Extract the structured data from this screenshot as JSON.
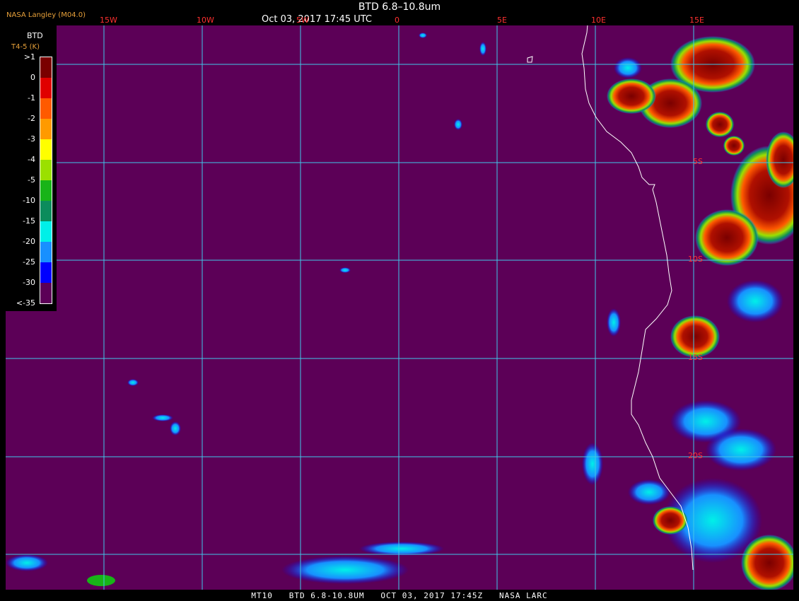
{
  "header": {
    "title": "BTD 6.8–10.8um",
    "time": "Oct 03, 2017 17:45 UTC",
    "source": "NASA Langley (M04.0)"
  },
  "legend": {
    "title": "BTD",
    "subtitle": "T4-5 (K)",
    "ticks": [
      ">1",
      "0",
      "-1",
      "-2",
      "-3",
      "-4",
      "-5",
      "-10",
      "-15",
      "-20",
      "-25",
      "-30",
      "<-35"
    ],
    "colors": [
      "#7a0000",
      "#e00000",
      "#ff5a00",
      "#ff9a00",
      "#ffff00",
      "#9be000",
      "#18b418",
      "#0b8c5c",
      "#00f0e8",
      "#1890ff",
      "#0000ff",
      "#5c0057"
    ]
  },
  "longitude_labels": [
    "15W",
    "10W",
    "5W",
    "0",
    "5E",
    "10E",
    "15E"
  ],
  "latitude_labels": [
    "5S",
    "10S",
    "15S",
    "20S"
  ],
  "footer": "MT10   BTD 6.8-10.8UM   OCT 03, 2017 17:45Z   NASA LARC",
  "colors": {
    "background": "#5c0057",
    "grid": "#40c8e8",
    "coast": "#ffffff",
    "labels": "#ff3030"
  }
}
